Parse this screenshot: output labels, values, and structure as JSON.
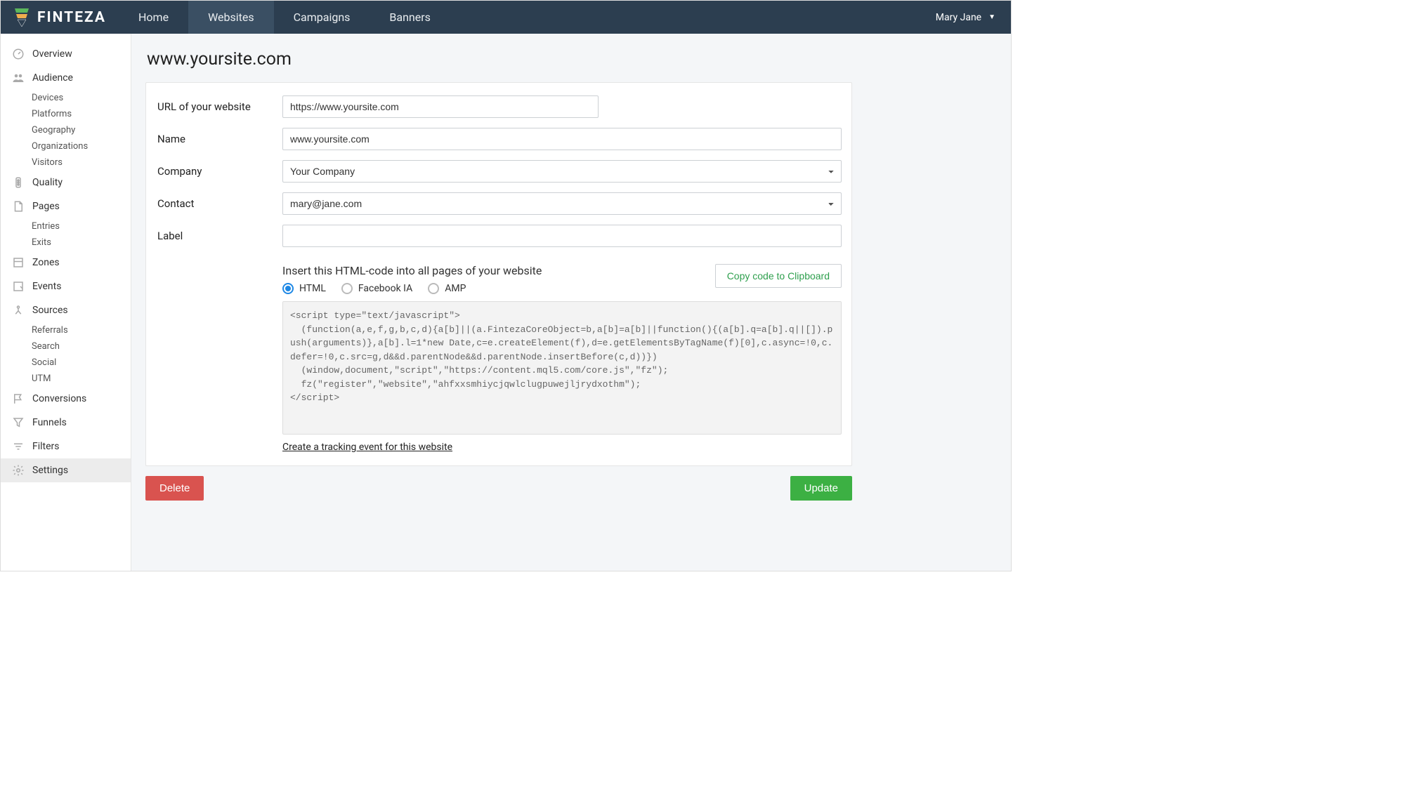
{
  "header": {
    "brand": "FINTEZA",
    "nav": [
      "Home",
      "Websites",
      "Campaigns",
      "Banners"
    ],
    "user": "Mary Jane"
  },
  "sidebar": [
    {
      "icon": "gauge",
      "label": "Overview"
    },
    {
      "icon": "people",
      "label": "Audience",
      "subs": [
        "Devices",
        "Platforms",
        "Geography",
        "Organizations",
        "Visitors"
      ]
    },
    {
      "icon": "traffic",
      "label": "Quality"
    },
    {
      "icon": "page",
      "label": "Pages",
      "subs": [
        "Entries",
        "Exits"
      ]
    },
    {
      "icon": "zone",
      "label": "Zones"
    },
    {
      "icon": "event",
      "label": "Events"
    },
    {
      "icon": "source",
      "label": "Sources",
      "subs": [
        "Referrals",
        "Search",
        "Social",
        "UTM"
      ]
    },
    {
      "icon": "flag",
      "label": "Conversions"
    },
    {
      "icon": "funnel",
      "label": "Funnels"
    },
    {
      "icon": "filter",
      "label": "Filters"
    },
    {
      "icon": "gear",
      "label": "Settings",
      "active": true
    }
  ],
  "page": {
    "title": "www.yoursite.com",
    "form": {
      "url_label": "URL of your website",
      "url_value": "https://www.yoursite.com",
      "name_label": "Name",
      "name_value": "www.yoursite.com",
      "company_label": "Company",
      "company_value": "Your Company",
      "contact_label": "Contact",
      "contact_value": "mary@jane.com",
      "label_label": "Label",
      "label_value": ""
    },
    "code": {
      "instruction": "Insert this HTML-code into all pages of your website",
      "radios": [
        "HTML",
        "Facebook IA",
        "AMP"
      ],
      "copy_btn": "Copy code to Clipboard",
      "snippet": "<script type=\"text/javascript\">\n  (function(a,e,f,g,b,c,d){a[b]||(a.FintezaCoreObject=b,a[b]=a[b]||function(){(a[b].q=a[b].q||[]).push(arguments)},a[b].l=1*new Date,c=e.createElement(f),d=e.getElementsByTagName(f)[0],c.async=!0,c.defer=!0,c.src=g,d&&d.parentNode&&d.parentNode.insertBefore(c,d))})\n  (window,document,\"script\",\"https://content.mql5.com/core.js\",\"fz\");\n  fz(\"register\",\"website\",\"ahfxxsmhiycjqwlclugpuwejljrydxothm\");\n</script>",
      "track_link": "Create a tracking event for this website"
    },
    "actions": {
      "delete": "Delete",
      "update": "Update"
    }
  }
}
